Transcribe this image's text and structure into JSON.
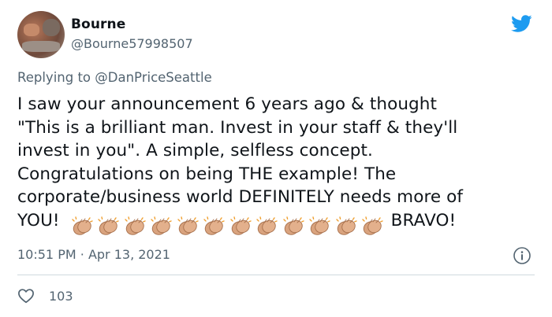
{
  "author": {
    "display_name": "Bourne",
    "handle": "@Bourne57998507"
  },
  "reply": {
    "prefix": "Replying to",
    "mention": "@DanPriceSeattle"
  },
  "tweet": {
    "lines": [
      "I saw your announcement 6 years ago & thought",
      "\"This is a brilliant man. Invest in your staff & they'll",
      "invest in you\". A simple, selfless concept.",
      "Congratulations on being THE example! The",
      "corporate/business world DEFINITELY needs more of"
    ],
    "last_line_start": "YOU!",
    "clap_emoji": "👏🏽",
    "clap_count": 12,
    "last_line_end": "BRAVO!"
  },
  "meta": {
    "time": "10:51 PM",
    "separator": "·",
    "date": "Apr 13, 2021"
  },
  "engagement": {
    "likes": "103"
  },
  "colors": {
    "twitter_blue": "#1d9bf0",
    "secondary_text": "#536471",
    "primary_text": "#0f1419",
    "clap_skin": "#d9a37e"
  },
  "icons": {
    "brand": "twitter-bird-icon",
    "info": "info-icon",
    "like": "heart-icon",
    "clap": "clapping-hands-emoji"
  }
}
